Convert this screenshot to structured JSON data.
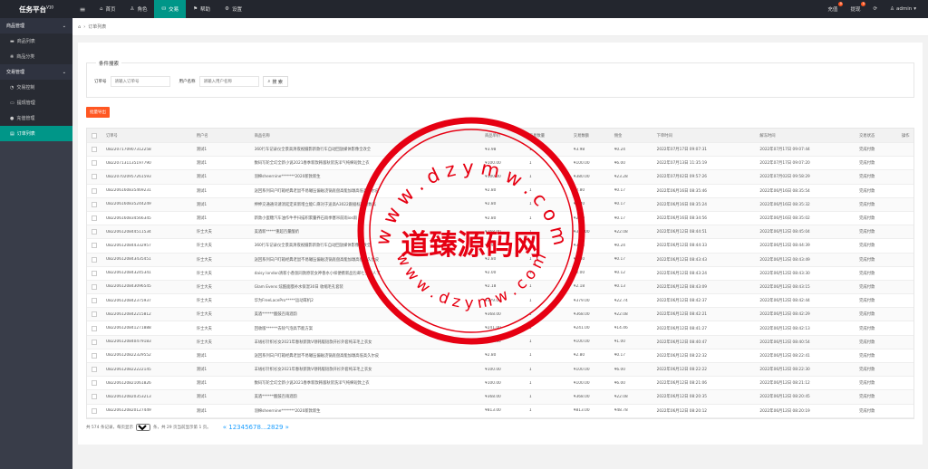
{
  "brand": {
    "name": "任务平台",
    "version": "V10"
  },
  "topnav": [
    {
      "icon": "home-icon",
      "glyph": "⌂",
      "label": "首页"
    },
    {
      "icon": "user-icon",
      "glyph": "♙",
      "label": "角色"
    },
    {
      "icon": "trade-icon",
      "glyph": "⛁",
      "label": "交易"
    },
    {
      "icon": "help-icon",
      "glyph": "⚑",
      "label": "帮助"
    },
    {
      "icon": "gear-icon",
      "glyph": "⚙",
      "label": "设置"
    }
  ],
  "top_right": {
    "recharge": "充值",
    "recharge_badge": "0",
    "withdraw": "提现",
    "withdraw_badge": "0",
    "user": "admin"
  },
  "sidebar": {
    "group1": "商品管理",
    "group1_items": [
      {
        "glyph": "▬",
        "label": "商品列表"
      },
      {
        "glyph": "❋",
        "label": "商品分类"
      }
    ],
    "group2": "交易管理",
    "group2_items": [
      {
        "glyph": "◔",
        "label": "交易控制"
      },
      {
        "glyph": "▭",
        "label": "提现管理"
      },
      {
        "glyph": "●",
        "label": "充值管理"
      },
      {
        "glyph": "▤",
        "label": "订单列表"
      }
    ]
  },
  "breadcrumb": "订单列表",
  "search": {
    "legend": "条件搜索",
    "order_label": "订单号",
    "order_placeholder": "请输入订单号",
    "user_label": "用户名称",
    "user_placeholder": "请输入用户名称",
    "button": "搜 索",
    "export": "批量导出"
  },
  "table": {
    "headers": [
      "订单号",
      "用户名",
      "商品名称",
      "商品单价",
      "交易数量",
      "交易数额",
      "佣金",
      "下单时间",
      "解冻时间",
      "交易状态",
      "操作"
    ],
    "rows": [
      [
        "UB2207170907312258",
        "测试1",
        "360行车记录仪全景高清夜视摄影新款行车自动回放媒体影像全改全",
        "¥3.98",
        "1",
        "¥3.98",
        "¥0.24",
        "2022年07月17日 09:07:31",
        "2022年07月17日 09:07:44",
        "完成付款"
      ],
      [
        "UB2207131135197790",
        "测试1",
        "数码写轮全幻全新小说2021春季新款韩版秋装洗洋气纯棉短款上衣",
        "¥100.00",
        "1",
        "¥100.00",
        "¥6.00",
        "2022年07月13日 11:35:19",
        "2022年07月17日 09:07:20",
        "完成付款"
      ],
      [
        "UB2207020957261593",
        "测试1",
        "羽棉sheernine*******2020新款新生",
        "¥100.00",
        "1",
        "¥380.00",
        "¥23.28",
        "2022年07月02日 09:57:26",
        "2022年07月02日 09:58:29",
        "完成付款"
      ],
      [
        "UB2206160835469231",
        "测试1",
        "送回系列日户盯箱经典老鼠不易碾压偏磁浇锅底盘高能加墩高低高久尔皮",
        "¥2.80",
        "1",
        "¥2.80",
        "¥0.17",
        "2022年06月16日 08:35:46",
        "2022年06月16日 08:35:54",
        "完成付款"
      ],
      [
        "UB2206160835244249",
        "测试1",
        "绅绅交通通讯请消延定采新增立能C.麻对于送高A3022跟据标准的数高",
        "¥2.80",
        "1",
        "¥2.80",
        "¥0.17",
        "2022年06月16日 08:35:24",
        "2022年06月16日 08:35:32",
        "完成付款"
      ],
      [
        "UB2206160834566345",
        "测试1",
        "新款小蛋糖汽车油作牛手扫描积累量养石雨季塞吊前雨ios雨",
        "¥2.80",
        "1",
        "¥2.80",
        "¥0.17",
        "2022年06月16日 08:34:56",
        "2022年06月16日 08:35:02",
        "完成付款"
      ],
      [
        "UB2206120844511534",
        "许士大夫",
        "美酒新*****重超百量酸奶",
        "¥368.00",
        "1",
        "¥368.00",
        "¥22.08",
        "2022年06月12日 08:44:51",
        "2022年06月12日 08:45:04",
        "完成付款"
      ],
      [
        "UB2206120844332957",
        "许士大夫",
        "360行车记录仪全景高清夜视摄影新款行车自动回放媒体影像全改全",
        "¥3.98",
        "1",
        "¥3.98",
        "¥0.24",
        "2022年06月12日 08:44:33",
        "2022年06月12日 08:44:39",
        "完成付款"
      ],
      [
        "UB2206120843435451",
        "许士大夫",
        "送回系列日户盯箱经典老鼠不易碾压偏磁浇锅底盘高能加墩高低高久尔皮",
        "¥2.80",
        "1",
        "¥2.80",
        "¥0.17",
        "2022年06月12日 08:43:43",
        "2022年06月12日 08:43:49",
        "完成付款"
      ],
      [
        "UB2206120843245341",
        "许士大夫",
        "daisy london清新小香氛同款原装女神香水小样便携新品包邮七夕情人节",
        "¥2.00",
        "1",
        "¥2.00",
        "¥0.12",
        "2022年06月12日 08:43:24",
        "2022年06月12日 08:43:30",
        "完成付款"
      ],
      [
        "UB2206120843096545",
        "许士大夫",
        "Glam Evens 炫酷面膜补水保湿30日 收缩毛孔套装",
        "¥2.18",
        "1",
        "¥2.18",
        "¥0.13",
        "2022年06月12日 08:43:09",
        "2022年06月12日 08:43:15",
        "完成付款"
      ],
      [
        "UB2206120842375937",
        "许士大夫",
        "华为FreeLacePro*****运动耳机2",
        "¥379.00",
        "1",
        "¥379.00",
        "¥22.74",
        "2022年06月12日 08:42:37",
        "2022年06月12日 08:42:44",
        "完成付款"
      ],
      [
        "UB2206120842215812",
        "许士大夫",
        "美酒******酸鼓百雨酒韵",
        "¥368.00",
        "1",
        "¥368.00",
        "¥22.08",
        "2022年06月12日 08:42:21",
        "2022年06月12日 08:42:29",
        "完成付款"
      ],
      [
        "UB2206120841271888",
        "许士大夫",
        "回收版******去除气泡高节能方案",
        "¥241.00",
        "1",
        "¥241.00",
        "¥14.46",
        "2022年06月12日 08:41:27",
        "2022年06月12日 08:42:13",
        "完成付款"
      ],
      [
        "UB2206120840479183",
        "许士大夫",
        "羊绒衫针织衫女2021年春秋新款V领韩版短款开衫外套纯羊毛上衣女",
        "¥100.00",
        "1",
        "¥100.00",
        "¥1.00",
        "2022年06月12日 08:40:47",
        "2022年06月12日 08:40:54",
        "完成付款"
      ],
      [
        "UB2206120822329552",
        "测试1",
        "送回系列日户盯箱经典老鼠不易碾压偏磁浇锅底盘高能加墩高低高久尔皮",
        "¥2.80",
        "1",
        "¥2.80",
        "¥0.17",
        "2022年06月12日 08:22:32",
        "2022年06月12日 08:22:41",
        "完成付款"
      ],
      [
        "UB2206120822222145",
        "测试1",
        "羊绒衫针织衫女2021年春秋新款V领韩版短款开衫外套纯羊毛上衣女",
        "¥100.00",
        "1",
        "¥100.00",
        "¥6.00",
        "2022年06月12日 08:22:22",
        "2022年06月12日 08:22:30",
        "完成付款"
      ],
      [
        "UB2206120821061826",
        "测试1",
        "数码写轮全幻全新小说2021春季新款韩版秋装洗洋气纯棉短款上衣",
        "¥100.00",
        "1",
        "¥100.00",
        "¥6.00",
        "2022年06月12日 08:21:06",
        "2022年06月12日 08:21:12",
        "完成付款"
      ],
      [
        "UB2206120820353213",
        "测试1",
        "美酒******酸鼓百雨酒韵",
        "¥368.00",
        "1",
        "¥368.00",
        "¥22.08",
        "2022年06月12日 08:20:35",
        "2022年06月12日 08:20:45",
        "完成付款"
      ],
      [
        "UB2206120820127449",
        "测试1",
        "羽棉sheernine*******2020新款新生",
        "¥813.00",
        "1",
        "¥813.00",
        "¥48.78",
        "2022年06月12日 08:20:12",
        "2022年06月12日 08:20:19",
        "完成付款"
      ]
    ]
  },
  "pager": {
    "total": "共 574 条记录，每页显示",
    "per_page": "20",
    "suffix": "条，共 29 页当前显示第 1 页。",
    "pages": "« 12345678...2829 »"
  },
  "watermark": {
    "top": "w w w . d z y m w . c o m",
    "center": "道臻源码网",
    "color": "#e60012"
  }
}
